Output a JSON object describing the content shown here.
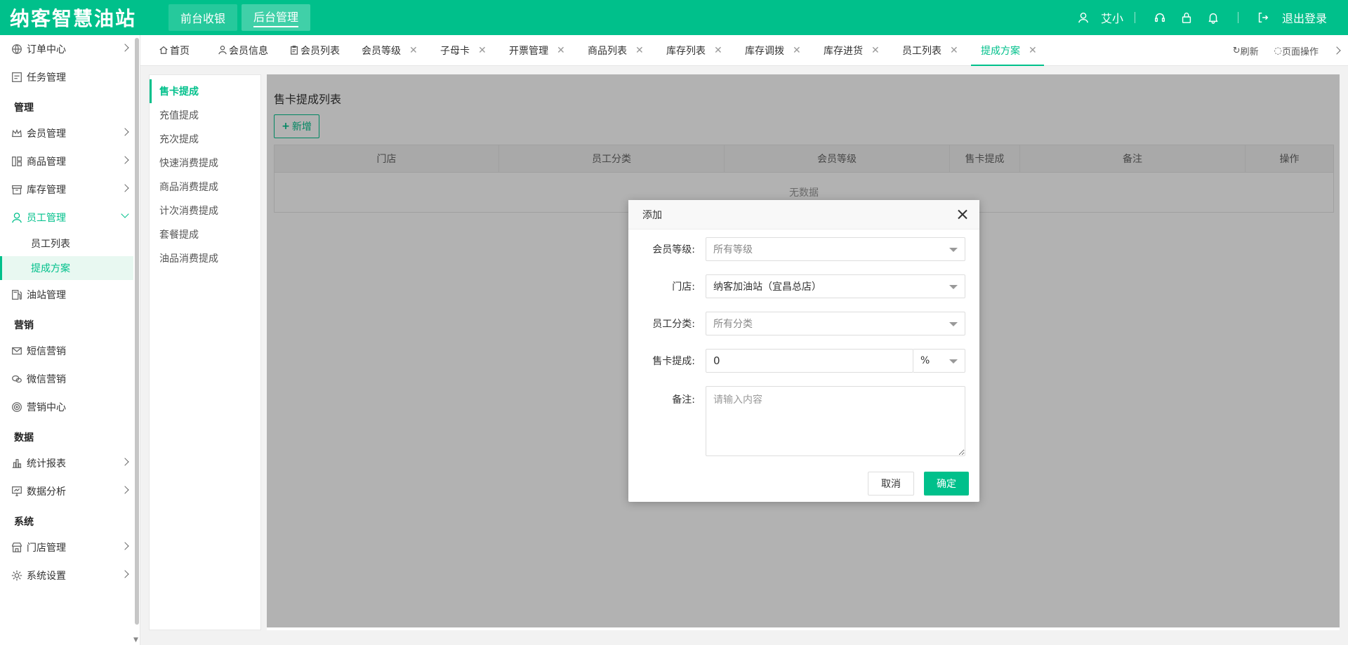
{
  "brand": {
    "logo_text": "纳客智慧油站",
    "accent": "#00c08b"
  },
  "top_nav": {
    "front": "前台收银",
    "back": "后台管理"
  },
  "user": {
    "name": "艾小",
    "logout": "退出登录"
  },
  "sidebar": {
    "items": {
      "order": "订单中心",
      "task": "任务管理",
      "group_manage": "管理",
      "member": "会员管理",
      "goods": "商品管理",
      "stock": "库存管理",
      "staff": "员工管理",
      "staff_list": "员工列表",
      "commission": "提成方案",
      "station": "油站管理",
      "group_marketing": "营销",
      "sms": "短信营销",
      "wechat": "微信营销",
      "marketing_center": "营销中心",
      "group_data": "数据",
      "stats": "统计报表",
      "analysis": "数据分析",
      "group_system": "系统",
      "store": "门店管理",
      "settings": "系统设置"
    }
  },
  "tabs": {
    "home": "首页",
    "member_info": "会员信息",
    "member_list": "会员列表",
    "member_level": "会员等级",
    "sub_card": "子母卡",
    "invoice": "开票管理",
    "goods_list": "商品列表",
    "stock_list": "库存列表",
    "stock_transfer": "库存调拨",
    "stock_purchase": "库存进货",
    "staff_list": "员工列表",
    "commission": "提成方案",
    "refresh": "刷新",
    "page_ops": "页面操作"
  },
  "inner_nav": {
    "card_sale": "售卡提成",
    "recharge": "充值提成",
    "recount": "充次提成",
    "quick": "快速消费提成",
    "goods": "商品消费提成",
    "count": "计次消费提成",
    "package": "套餐提成",
    "oil": "油品消费提成"
  },
  "panel": {
    "title": "售卡提成列表",
    "add_button": "新增",
    "columns": [
      "门店",
      "员工分类",
      "会员等级",
      "售卡提成",
      "备注",
      "操作"
    ],
    "empty_text": "无数据"
  },
  "modal": {
    "title": "添加",
    "fields": {
      "level_label": "会员等级:",
      "level_value": "所有等级",
      "store_label": "门店:",
      "store_value": "纳客加油站（宜昌总店）",
      "staff_type_label": "员工分类:",
      "staff_type_value": "所有分类",
      "commission_label": "售卡提成:",
      "commission_value": "0",
      "unit_value": "%",
      "remark_label": "备注:",
      "remark_placeholder": "请输入内容"
    },
    "cancel": "取消",
    "confirm": "确定"
  }
}
